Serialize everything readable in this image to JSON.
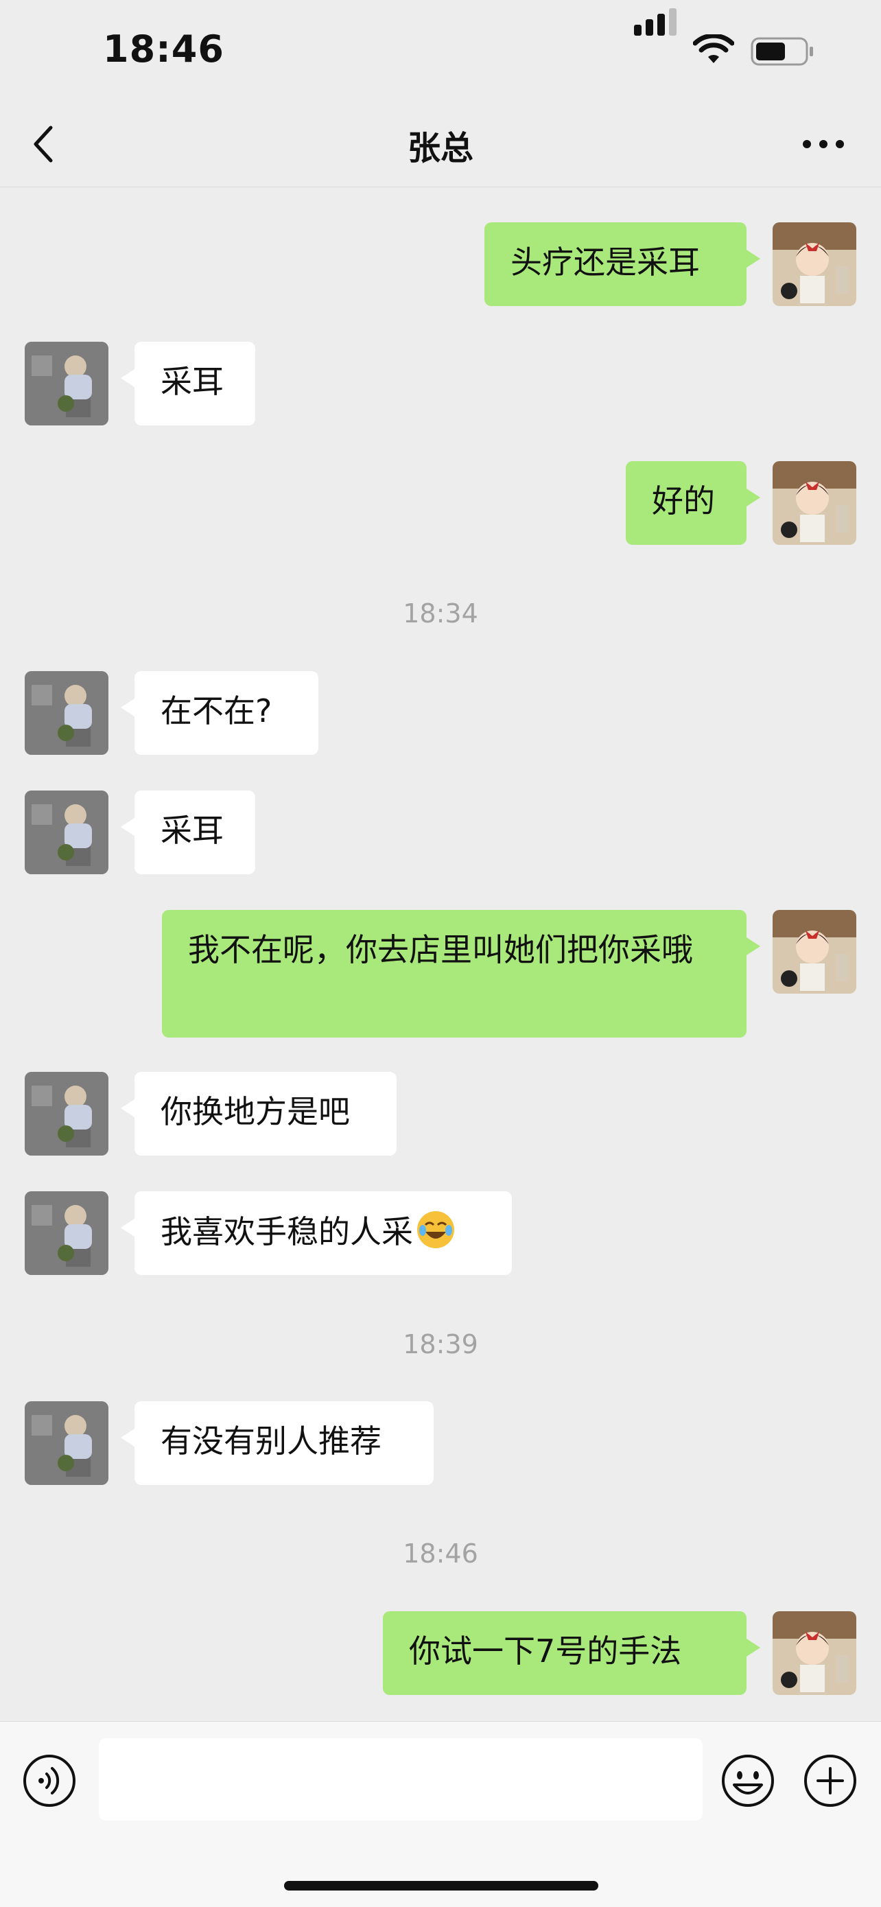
{
  "status": {
    "time": "18:46"
  },
  "nav": {
    "title": "张总",
    "back_icon": "chevron-left-icon",
    "more_icon": "more-dots-icon"
  },
  "messages": [
    {
      "side": "out",
      "text": "头疗还是采耳"
    },
    {
      "side": "in",
      "text": "采耳"
    },
    {
      "side": "out",
      "text": "好的"
    },
    {
      "timestamp": "18:34"
    },
    {
      "side": "in",
      "text": "在不在?"
    },
    {
      "side": "in",
      "text": "采耳"
    },
    {
      "side": "out",
      "text": "我不在呢，你去店里叫她们把你采哦"
    },
    {
      "side": "in",
      "text": "你换地方是吧"
    },
    {
      "side": "in",
      "text": "我喜欢手稳的人采",
      "emoji": "rolling-laughing-emoji"
    },
    {
      "timestamp": "18:39"
    },
    {
      "side": "in",
      "text": "有没有别人推荐"
    },
    {
      "timestamp": "18:46"
    },
    {
      "side": "out",
      "text": "你试一下7号的手法"
    }
  ],
  "bubble_colors": {
    "outgoing": "#a9e87a",
    "incoming": "#ffffff"
  },
  "input": {
    "placeholder": ""
  },
  "bottom_icons": [
    "voice-icon",
    "emoji-icon",
    "plus-icon"
  ]
}
